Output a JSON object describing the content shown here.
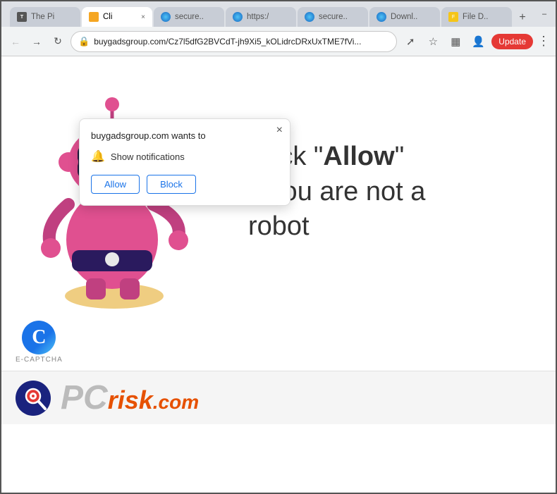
{
  "browser": {
    "tabs": [
      {
        "id": "tab-1",
        "label": "The Pi",
        "active": false,
        "favicon": "the"
      },
      {
        "id": "tab-2",
        "label": "Cli",
        "active": true,
        "favicon": "cli"
      },
      {
        "id": "tab-3",
        "label": "secure..",
        "active": false,
        "favicon": "globe"
      },
      {
        "id": "tab-4",
        "label": "https:/",
        "active": false,
        "favicon": "globe2"
      },
      {
        "id": "tab-5",
        "label": "secure..",
        "active": false,
        "favicon": "globe3"
      },
      {
        "id": "tab-6",
        "label": "Downl..",
        "active": false,
        "favicon": "globe4"
      },
      {
        "id": "tab-7",
        "label": "File D..",
        "active": false,
        "favicon": "file"
      }
    ],
    "url": "buygadsgroup.com/Cz7l5dfG2BVCdT-jh9Xi5_kOLidrcDRxUxTME7fVi...",
    "update_button": "Update"
  },
  "popup": {
    "title": "buygadsgroup.com wants to",
    "notification_text": "Show notifications",
    "allow_label": "Allow",
    "block_label": "Block"
  },
  "page": {
    "captcha_line1": "Click \"",
    "captcha_allow": "Allow",
    "captcha_line2": "\"",
    "captcha_line3": "if you are not a",
    "captcha_line4": "robot",
    "ecaptcha_label": "E-CAPTCHA"
  },
  "pcrisk": {
    "logo_pc": "PC",
    "logo_risk": "risk",
    "logo_com": ".com"
  }
}
